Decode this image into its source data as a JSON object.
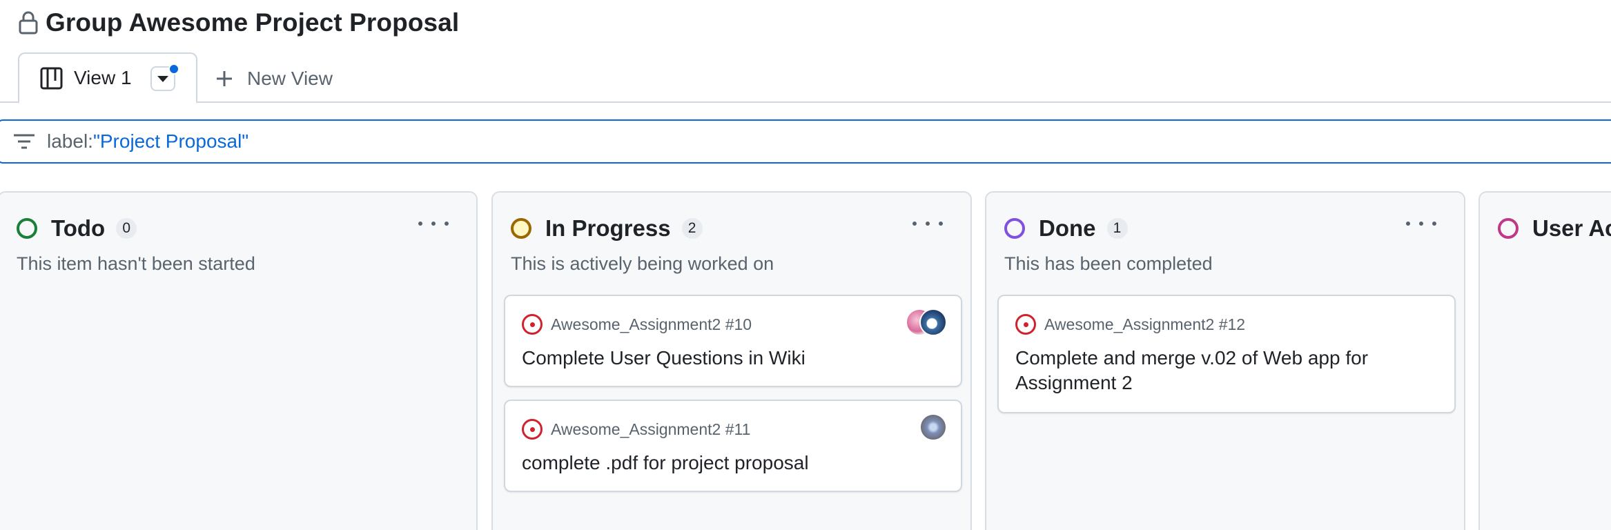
{
  "project": {
    "title": "Group Awesome Project Proposal",
    "lock_icon": "lock-icon"
  },
  "views": {
    "active_tab_label": "View 1",
    "new_view_label": "New View"
  },
  "filter": {
    "key": "label:",
    "value": "\"Project Proposal\""
  },
  "colors": {
    "todo": "#1a7f37",
    "in_progress": "#9a6700",
    "done": "#8250df",
    "user_acceptance": "#bf3989",
    "issue_open": "#cf222e",
    "accent": "#0969da"
  },
  "columns": [
    {
      "name": "Todo",
      "count": "0",
      "description": "This item hasn't been started",
      "cards": []
    },
    {
      "name": "In Progress",
      "count": "2",
      "description": "This is actively being worked on",
      "cards": [
        {
          "repo": "Awesome_Assignment2 #10",
          "title": "Complete User Questions in Wiki"
        },
        {
          "repo": "Awesome_Assignment2 #11",
          "title": "complete .pdf for project proposal"
        }
      ]
    },
    {
      "name": "Done",
      "count": "1",
      "description": "This has been completed",
      "cards": [
        {
          "repo": "Awesome_Assignment2 #12",
          "title": "Complete and merge v.02 of Web app for Assignment 2"
        }
      ]
    },
    {
      "name": "User Ac",
      "count": "",
      "description": "",
      "cards": []
    }
  ]
}
